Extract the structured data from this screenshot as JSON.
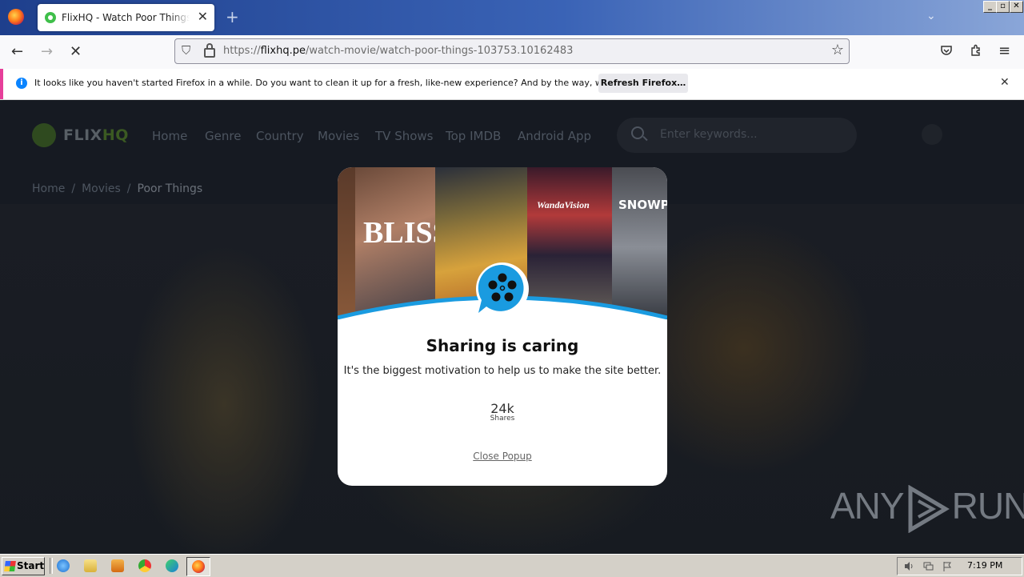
{
  "browser": {
    "tab_title": "FlixHQ - Watch Poor Things Free Sti",
    "new_tab_icon": "plus-icon",
    "url_prefix": "https://",
    "url_host": "flixhq.pe",
    "url_path": "/watch-movie/watch-poor-things-103753.10162483"
  },
  "notification": {
    "text": "It looks like you haven't started Firefox in a while. Do you want to clean it up for a fresh, like-new experience? And by the way, welcome back!",
    "button": "Refresh Firefox…",
    "accent_color": "#e63f9a"
  },
  "site": {
    "logo_main": "FLIX",
    "logo_hq": "HQ",
    "nav": [
      "Home",
      "Genre",
      "Country",
      "Movies",
      "TV Shows",
      "Top IMDB",
      "Android App"
    ],
    "search_placeholder": "Enter keywords...",
    "breadcrumb": [
      "Home",
      "Movies",
      "Poor Things"
    ]
  },
  "popup": {
    "poster_texts": [
      "BLISS",
      "WandaVision",
      "SNOWPIE"
    ],
    "title": "Sharing is caring",
    "subtitle": "It's the biggest motivation to help us to make the site better.",
    "share_count": "24k",
    "share_label": "Shares",
    "close_label": "Close Popup",
    "accent_color": "#1a9be0"
  },
  "watermark": {
    "left": "ANY",
    "right": "RUN"
  },
  "taskbar": {
    "start_label": "Start",
    "clock": "7:19 PM"
  }
}
